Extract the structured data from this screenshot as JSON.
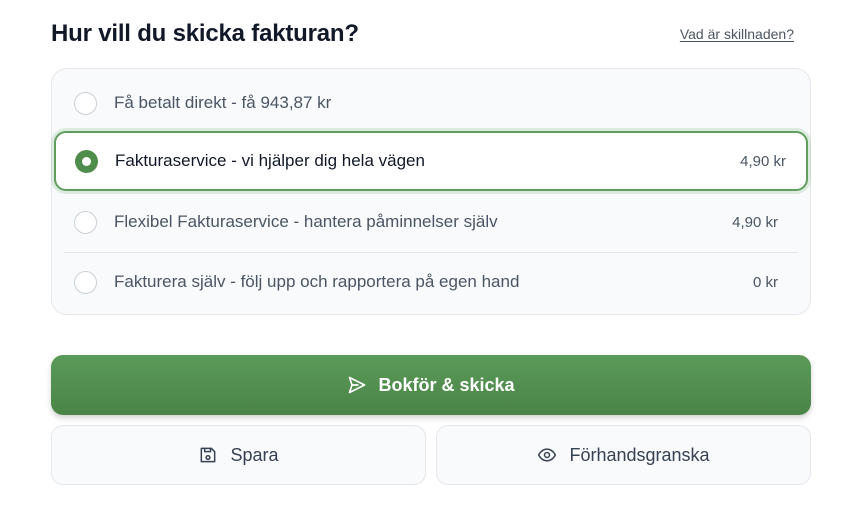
{
  "header": {
    "title": "Hur vill du skicka fakturan?",
    "help_link": "Vad är skillnaden?"
  },
  "options": [
    {
      "label": "Få betalt direkt - få 943,87 kr",
      "price": "",
      "selected": false
    },
    {
      "label": "Fakturaservice - vi hjälper dig hela vägen",
      "price": "4,90 kr",
      "selected": true
    },
    {
      "label": "Flexibel Fakturaservice - hantera påminnelser själv",
      "price": "4,90 kr",
      "selected": false
    },
    {
      "label": "Fakturera själv - följ upp och rapportera på egen hand",
      "price": "0 kr",
      "selected": false
    }
  ],
  "actions": {
    "primary_label": "Bokför & skicka",
    "save_label": "Spara",
    "preview_label": "Förhandsgranska"
  },
  "icons": {
    "primary": "send-icon",
    "save": "save-icon",
    "preview": "eye-icon"
  },
  "colors": {
    "accent": "#4e8d4b",
    "accent_border": "#5f9e5c"
  }
}
